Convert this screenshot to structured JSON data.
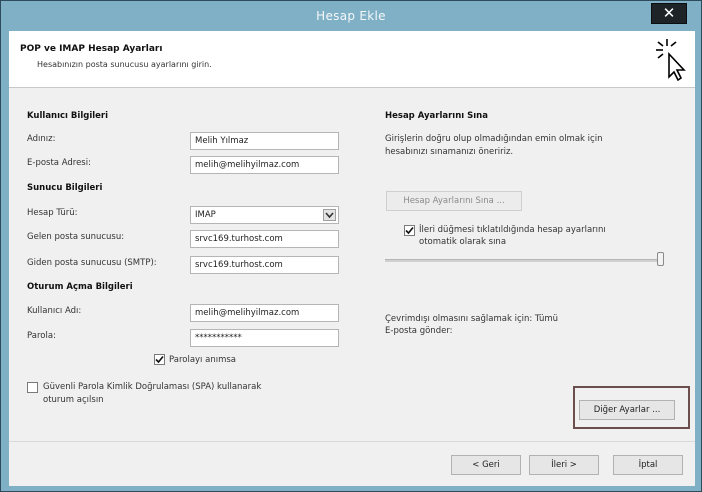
{
  "window": {
    "title": "Hesap Ekle",
    "close_label": "✕"
  },
  "header": {
    "title": "POP ve IMAP Hesap Ayarları",
    "subtitle": "Hesabınızın posta sunucusu ayarlarını girin."
  },
  "user_info": {
    "heading": "Kullanıcı Bilgileri",
    "name_label": "Adınız:",
    "name_value": "Melih Yılmaz",
    "email_label": "E-posta Adresi:",
    "email_value": "melih@melihyilmaz.com"
  },
  "server_info": {
    "heading": "Sunucu Bilgileri",
    "type_label": "Hesap Türü:",
    "type_value": "IMAP",
    "incoming_label": "Gelen posta sunucusu:",
    "incoming_value": "srvc169.turhost.com",
    "outgoing_label": "Giden posta sunucusu (SMTP):",
    "outgoing_value": "srvc169.turhost.com"
  },
  "logon_info": {
    "heading": "Oturum Açma Bilgileri",
    "username_label": "Kullanıcı Adı:",
    "username_value": "melih@melihyilmaz.com",
    "password_label": "Parola:",
    "password_value": "***********",
    "remember_label": "Parolayı anımsa",
    "remember_checked": true,
    "spa_label_line1": "Güvenli Parola Kimlik Doğrulaması (SPA) kullanarak",
    "spa_label_line2": "oturum açılsın",
    "spa_checked": false
  },
  "test_settings": {
    "heading": "Hesap Ayarlarını Sına",
    "desc_line1": "Girişlerin doğru olup olmadığından emin olmak için",
    "desc_line2": "hesabınızı sınamanızı öneririz.",
    "test_button": "Hesap Ayarlarını Sına ...",
    "auto_test_line1": "İleri düğmesi tıklatıldığında hesap ayarlarını",
    "auto_test_line2": "otomatik olarak sına",
    "auto_test_checked": true
  },
  "offline": {
    "line1": "Çevrimdışı olmasını sağlamak için:   Tümü",
    "line2": "E-posta gönder:",
    "slider_value": "Tümü",
    "slider_fraction": 1.0
  },
  "buttons": {
    "more_settings": "Diğer Ayarlar ...",
    "back": "< Geri",
    "next": "İleri >",
    "cancel": "İptal"
  },
  "colors": {
    "title_bar": "#7fb0c6",
    "panel": "#f0f0f0",
    "highlight_border": "#6b4e4e"
  }
}
